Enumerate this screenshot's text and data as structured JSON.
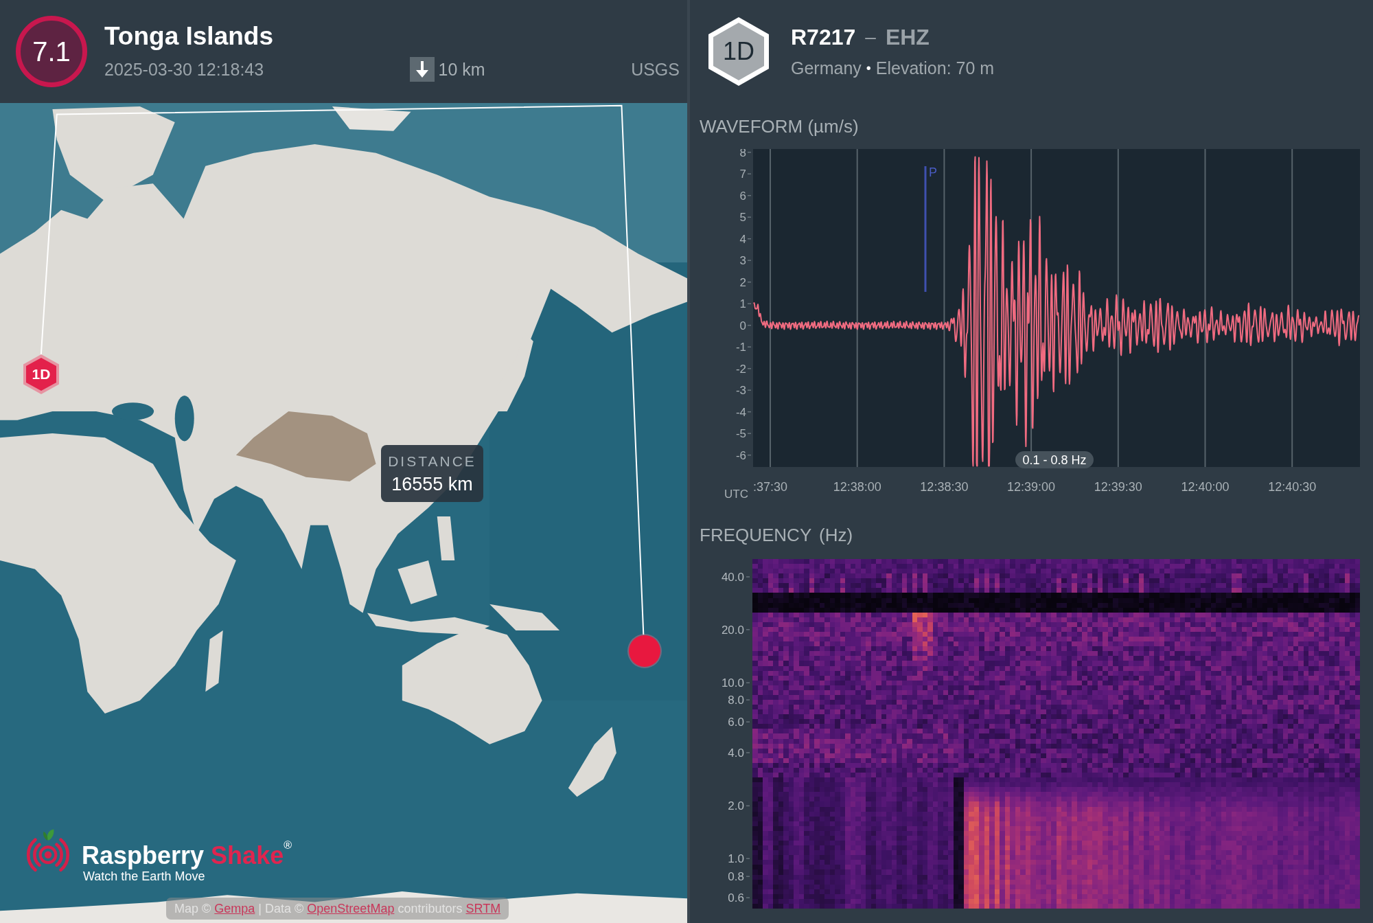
{
  "event": {
    "magnitude": "7.1",
    "region": "Tonga Islands",
    "time": "2025-03-30 12:18:43",
    "depth": "10 km",
    "source": "USGS"
  },
  "map": {
    "station_marker": "1D",
    "distance": {
      "label": "DISTANCE",
      "value": "16555 km"
    },
    "logo": {
      "name": [
        "Raspberry",
        "Shake"
      ],
      "registered_mark": "®",
      "tagline": "Watch the Earth Move"
    },
    "attribution": [
      {
        "kind": "text",
        "text": "Map ©"
      },
      {
        "kind": "link",
        "text": "Gempa"
      },
      {
        "kind": "text",
        "text": "| Data ©"
      },
      {
        "kind": "link",
        "text": "OpenStreetMap"
      },
      {
        "kind": "text",
        "text": "contributors"
      },
      {
        "kind": "link",
        "text": "SRTM"
      }
    ]
  },
  "station": {
    "network": "1D",
    "code": "R7217",
    "separator": "–",
    "channel": "EHZ",
    "country": "Germany",
    "bullet": "•",
    "elevation": "Elevation: 70 m"
  },
  "waveform": {
    "title": "WAVEFORM (µm/s)",
    "y_ticks": [
      "8",
      "7",
      "6",
      "5",
      "4",
      "3",
      "2",
      "1",
      "0",
      "-1",
      "-2",
      "-3",
      "-4",
      "-5",
      "-6"
    ],
    "x_ticks": [
      ":37:30",
      "12:38:00",
      "12:38:30",
      "12:39:00",
      "12:39:30",
      "12:40:00",
      "12:40:30"
    ],
    "time_zone": "UTC",
    "phase_marker": "P",
    "filter": "0.1 - 0.8 Hz"
  },
  "spectrogram": {
    "title": "FREQUENCY (Hz)",
    "y_ticks": [
      "40.0",
      "20.0",
      "10.0",
      "8.0",
      "6.0",
      "4.0",
      "2.0",
      "1.0",
      "0.8",
      "0.6"
    ]
  }
}
